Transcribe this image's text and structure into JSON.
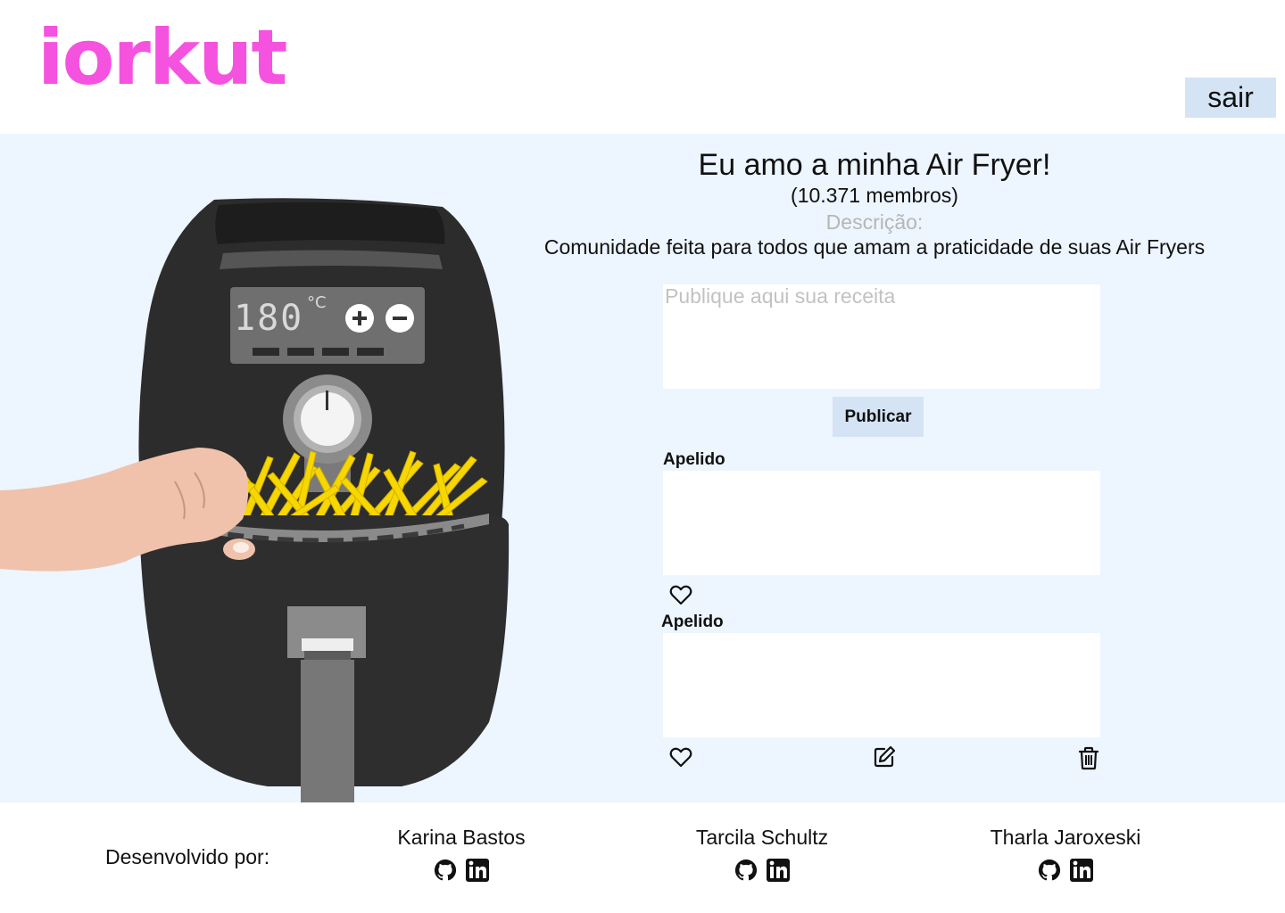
{
  "header": {
    "logo": "iorkut",
    "logout_label": "sair"
  },
  "community": {
    "title": "Eu amo a minha Air Fryer!",
    "members": "(10.371 membros)",
    "description_label": "Descrição:",
    "description": "Comunidade feita para todos que amam a praticidade de suas Air Fryers",
    "illustration": {
      "display_temp": "180",
      "display_unit": "°C"
    }
  },
  "composer": {
    "placeholder": "Publique aqui sua receita",
    "publish_label": "Publicar"
  },
  "posts": [
    {
      "author": "Apelido",
      "text": "",
      "icons": [
        "heart-icon"
      ]
    },
    {
      "author": "Apelido",
      "text": "",
      "icons": [
        "heart-icon",
        "edit-icon",
        "trash-icon"
      ]
    }
  ],
  "footer": {
    "label": "Desenvolvido por:",
    "developers": [
      {
        "name": "Karina Bastos",
        "icons": [
          "github-icon",
          "linkedin-icon"
        ]
      },
      {
        "name": "Tarcila Schultz",
        "icons": [
          "github-icon",
          "linkedin-icon"
        ]
      },
      {
        "name": "Tharla Jaroxeski",
        "icons": [
          "github-icon",
          "linkedin-icon"
        ]
      }
    ]
  },
  "colors": {
    "brand": "#f552e0",
    "button_bg": "#d4e4f5",
    "main_bg": "#edf5fe",
    "fryer_body": "#2b2b2b",
    "fries": "#f7d700",
    "hand": "#f0c2ab"
  }
}
